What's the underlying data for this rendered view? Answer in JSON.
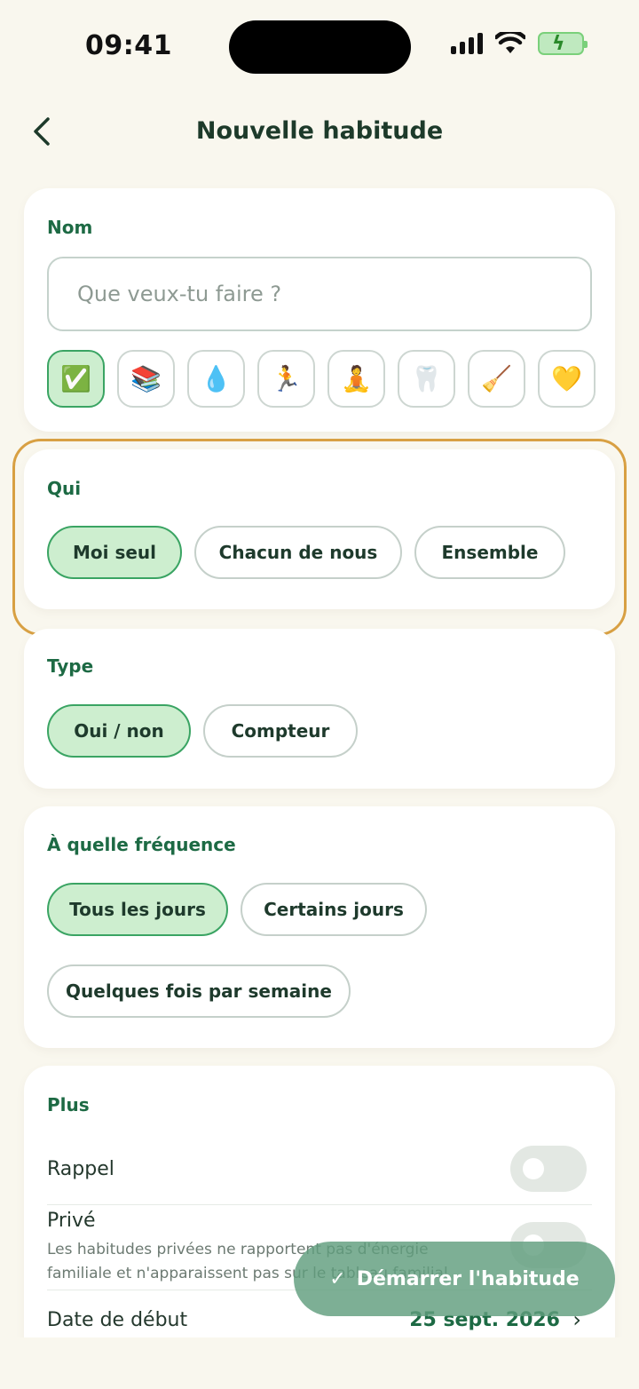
{
  "status_bar": {
    "time": "09:41"
  },
  "header": {
    "title": "Nouvelle habitude"
  },
  "name_section": {
    "label": "Nom",
    "placeholder": "Que veux-tu faire ?",
    "emojis": [
      "✅",
      "📚",
      "💧",
      "🏃",
      "🧘",
      "🦷",
      "🧹",
      "💛"
    ]
  },
  "who_section": {
    "label": "Qui",
    "options": [
      "Moi seul",
      "Chacun de nous",
      "Ensemble"
    ],
    "selected": "Moi seul"
  },
  "type_section": {
    "label": "Type",
    "options": [
      "Oui / non",
      "Compteur"
    ],
    "selected": "Oui / non"
  },
  "frequency_section": {
    "label": "À quelle fréquence",
    "options": [
      "Tous les jours",
      "Certains jours",
      "Quelques fois par semaine"
    ],
    "selected": "Tous les jours"
  },
  "more_section": {
    "label": "Plus",
    "reminder_label": "Rappel",
    "private_label": "Privé",
    "private_description": "Les habitudes privées ne rapportent pas d'énergie familiale et n'apparaissent pas sur le tableau familial.",
    "start_date_label": "Date de début",
    "start_date_value": "25 sept. 2026"
  },
  "fab": {
    "label": "Démarrer l'habitude"
  },
  "colors": {
    "accent": "#1d6a44",
    "selected_chip": "#cdeecf",
    "highlight": "#d8a043"
  }
}
